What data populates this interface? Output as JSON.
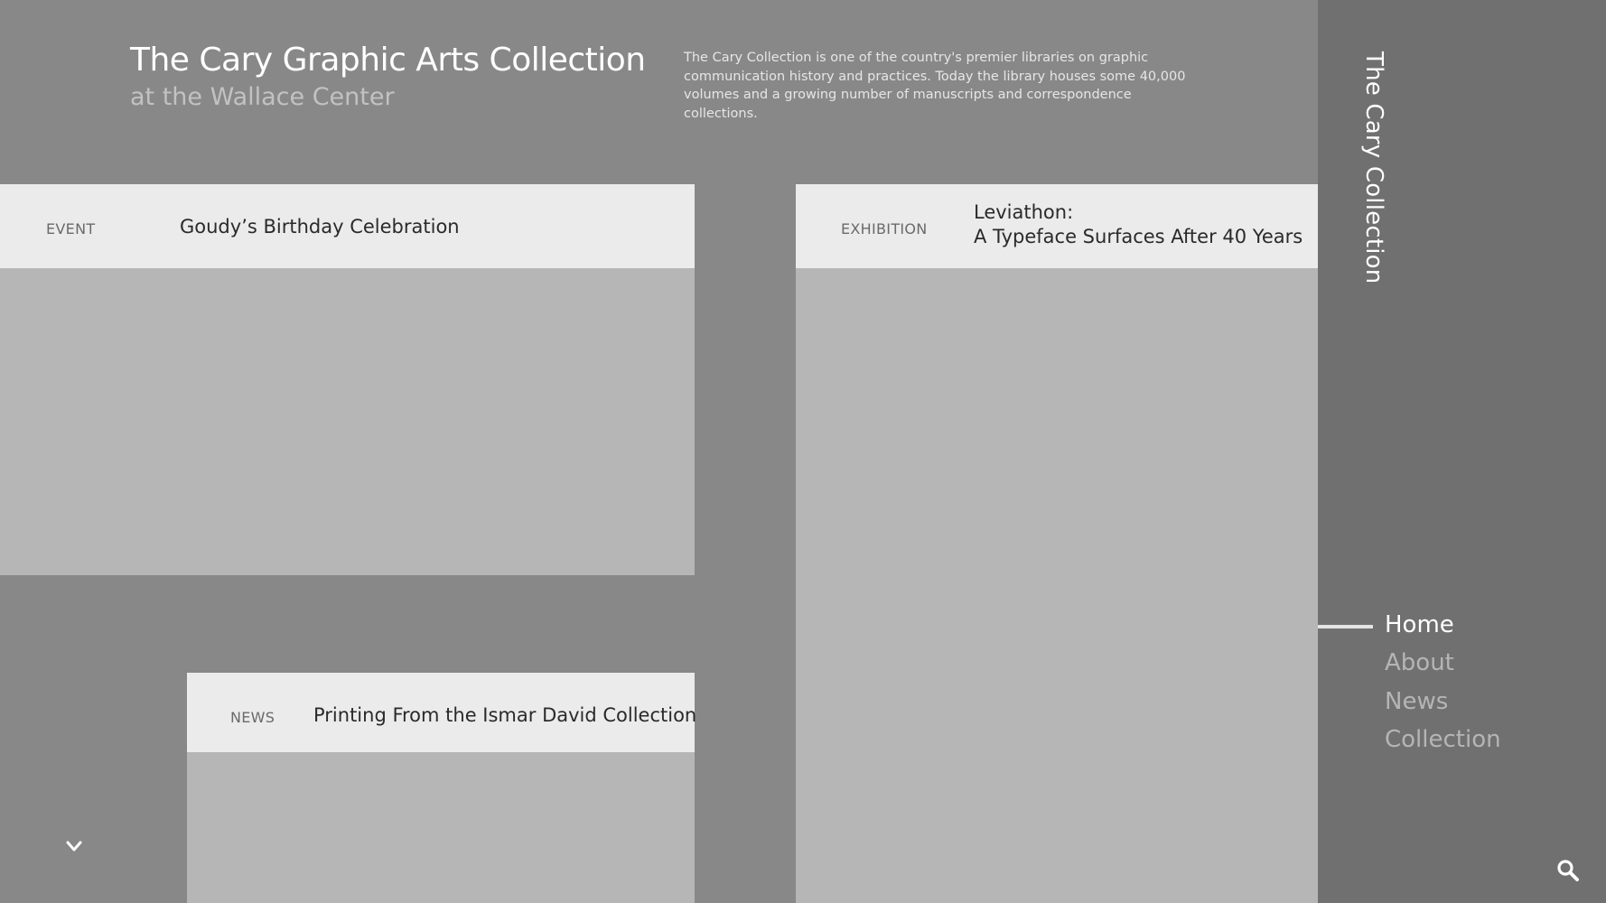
{
  "header": {
    "title": "The Cary Graphic Arts Collection",
    "subtitle": "at the Wallace Center",
    "description": "The Cary Collection is one of the country's premier libraries on graphic communication history and practices. Today the library houses some 40,000 volumes and a growing number of manuscripts and correspondence collections."
  },
  "cards": {
    "event": {
      "label": "EVENT",
      "title": "Goudy’s Birthday Celebration"
    },
    "exhibition": {
      "label": "EXHIBITION",
      "title_line1": "Leviathon:",
      "title_line2": "A Typeface Surfaces After 40 Years"
    },
    "news": {
      "label": "NEWS",
      "title": "Printing From the Ismar David Collection"
    }
  },
  "sidebar": {
    "brand": "The Cary Collection",
    "nav": [
      {
        "label": "Home",
        "active": true
      },
      {
        "label": "About",
        "active": false
      },
      {
        "label": "News",
        "active": false
      },
      {
        "label": "Collection",
        "active": false
      }
    ]
  },
  "icons": {
    "scroll": "chevron-down-icon",
    "search": "search-icon"
  },
  "colors": {
    "main_bg": "#888888",
    "sidebar_bg": "#707070",
    "card_header_bg": "#ebebeb",
    "card_image_bg": "#b6b6b6",
    "nav_inactive": "#b5b5b5",
    "nav_active": "#ffffff"
  }
}
